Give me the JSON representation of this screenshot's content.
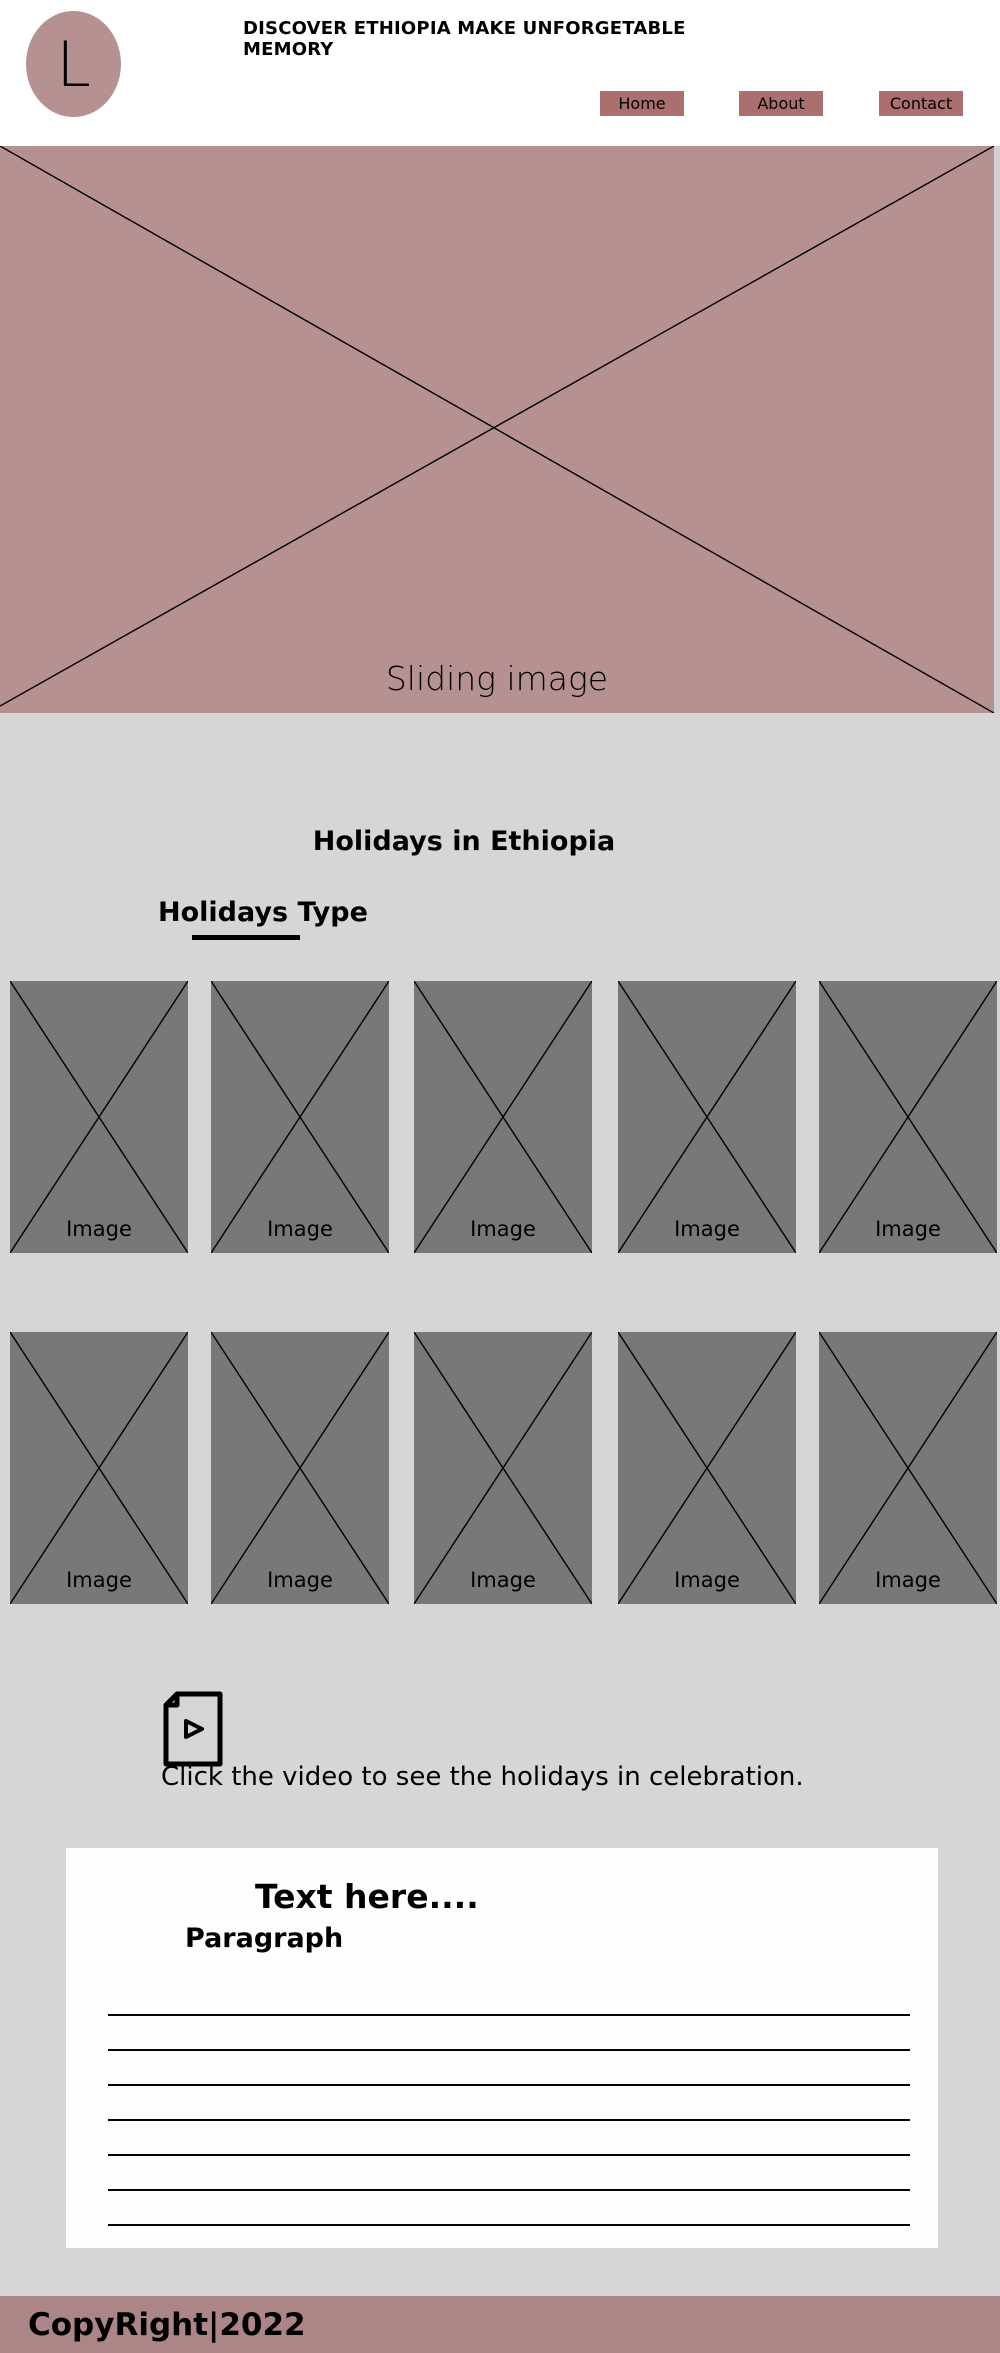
{
  "header": {
    "logo_letter": "L",
    "title": "DISCOVER ETHIOPIA MAKE UNFORGETABLE MEMORY",
    "nav": [
      "Home",
      "About",
      "Contact"
    ]
  },
  "hero": {
    "caption": "Sliding image"
  },
  "holidays": {
    "title": "Holidays in Ethiopia",
    "subtitle": "Holidays Type",
    "images": [
      "Image",
      "Image",
      "Image",
      "Image",
      "Image",
      "Image",
      "Image",
      "Image",
      "Image",
      "Image"
    ]
  },
  "video": {
    "icon": "video-file-icon",
    "text": "Click the video to see the holidays in celebration."
  },
  "panel": {
    "heading": "Text here....",
    "subheading": "Paragraph",
    "line_count": 7
  },
  "footer": {
    "copyright": "CopyRight|2022"
  },
  "colors": {
    "logo": "#b59191",
    "nav_button": "#ab6f70",
    "hero": "#b59192",
    "section_bg": "#d6d6d6",
    "card": "#787878",
    "footer": "#ac8587"
  }
}
